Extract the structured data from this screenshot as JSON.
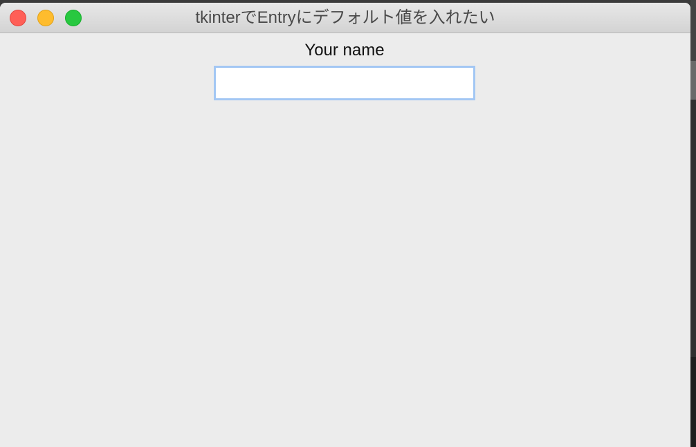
{
  "window": {
    "title": "tkinterでEntryにデフォルト値を入れたい"
  },
  "form": {
    "label": "Your name",
    "entry_value": ""
  },
  "colors": {
    "close": "#ff5f57",
    "minimize": "#febc2e",
    "zoom": "#28c840",
    "focus_ring": "#a3c7f4",
    "window_bg": "#ececec"
  }
}
